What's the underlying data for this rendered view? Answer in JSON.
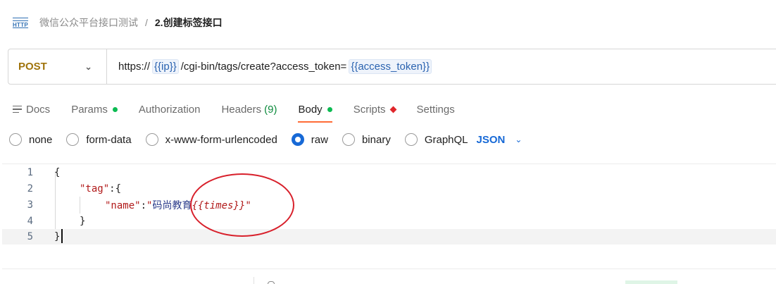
{
  "breadcrumb": {
    "icon_text": "HTTP",
    "parent": "微信公众平台接口测试",
    "separator": "/",
    "current": "2.创建标签接口"
  },
  "request": {
    "method": "POST",
    "url_prefix": "https://",
    "url_var_ip": "{{ip}}",
    "url_path": "/cgi-bin/tags/create?access_token=",
    "url_var_token": "{{access_token}}"
  },
  "tabs": [
    {
      "label": "Docs"
    },
    {
      "label": "Params"
    },
    {
      "label": "Authorization"
    },
    {
      "label": "Headers",
      "count": "(9)"
    },
    {
      "label": "Body"
    },
    {
      "label": "Scripts"
    },
    {
      "label": "Settings"
    }
  ],
  "body_types": {
    "options": [
      "none",
      "form-data",
      "x-www-form-urlencoded",
      "raw",
      "binary",
      "GraphQL"
    ],
    "selected": "raw",
    "language": "JSON"
  },
  "editor": {
    "line_numbers": [
      "1",
      "2",
      "3",
      "4",
      "5"
    ],
    "l1": "{",
    "l2_key": "\"tag\"",
    "l2_rest": ":{",
    "l3_key": "\"name\"",
    "l3_colon": ":",
    "l3_quote_open": "\"",
    "l3_cn": "码尚教育",
    "l3_var": "{{times}}",
    "l3_quote_close": "\"",
    "l4": "}",
    "l5": "}"
  },
  "colors": {
    "method": "#a0740c",
    "accent": "#ff6c37",
    "link": "#1769d6",
    "annotation": "#d8202b"
  }
}
